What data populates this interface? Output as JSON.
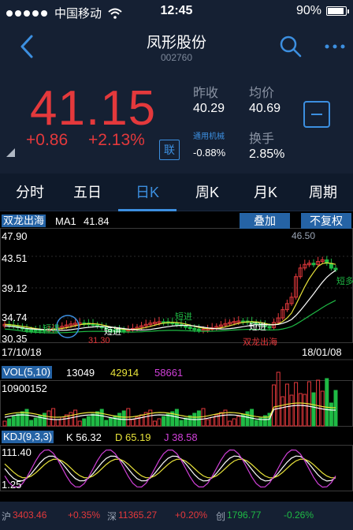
{
  "status": {
    "carrier": "中国移动",
    "time": "12:45",
    "battery": "90%",
    "battery_level": 0.9
  },
  "nav": {
    "stock_name": "凤形股份",
    "stock_code": "002760"
  },
  "quote": {
    "price": "41.15",
    "change": "+0.86",
    "change_pct": "+2.13%",
    "lian_label": "联",
    "prev_close_label": "昨收",
    "prev_close": "40.29",
    "avg_label": "均价",
    "avg": "40.69",
    "industry": "通用机械",
    "industry_change": "-0.88%",
    "turnover_label": "换手",
    "turnover": "2.85%"
  },
  "tabs": [
    {
      "label": "分时",
      "active": false
    },
    {
      "label": "五日",
      "active": false
    },
    {
      "label": "日K",
      "active": true
    },
    {
      "label": "周K",
      "active": false
    },
    {
      "label": "月K",
      "active": false
    },
    {
      "label": "周期",
      "active": false
    }
  ],
  "kline": {
    "indicator": "双龙出海",
    "ma_label": "MA1",
    "ma_value": "41.84",
    "overlay_button": "叠加",
    "adjust_button": "不复权",
    "y_top": "47.90",
    "y_mid1": "43.51",
    "y_mid2": "39.12",
    "y_mid3": "34.74",
    "y_bottom": "30.35",
    "high_mark": "46.50",
    "low_mark": "31.30",
    "date_start": "17/10/18",
    "date_end": "18/01/08",
    "annotations": [
      "短进",
      "双龙出海",
      "短进",
      "短进",
      "短进",
      "短多"
    ]
  },
  "vol": {
    "label": "VOL(5,10)",
    "v1": "13049",
    "v2": "42914",
    "v3": "58661",
    "max": "10900152"
  },
  "kdj": {
    "label": "KDJ(9,3,3)",
    "k": "K 56.32",
    "d": "D 65.19",
    "j": "J 38.58",
    "top": "111.40",
    "bottom": "1.25"
  },
  "ticker": {
    "sh_label": "沪",
    "sh_value": "3403.46",
    "sh_change": "+0.35%",
    "sz_label": "深",
    "sz_value": "11365.27",
    "sz_change": "+0.20%",
    "cy_label": "创",
    "cy_value": "1796.77",
    "cy_change": "-0.26%"
  },
  "colors": {
    "up": "#e4393c",
    "down": "#1fba45",
    "accent": "#3c8fe0",
    "ma_yellow": "#e8e33a",
    "ma_green": "#1fba45",
    "j_magenta": "#d040d8"
  }
}
